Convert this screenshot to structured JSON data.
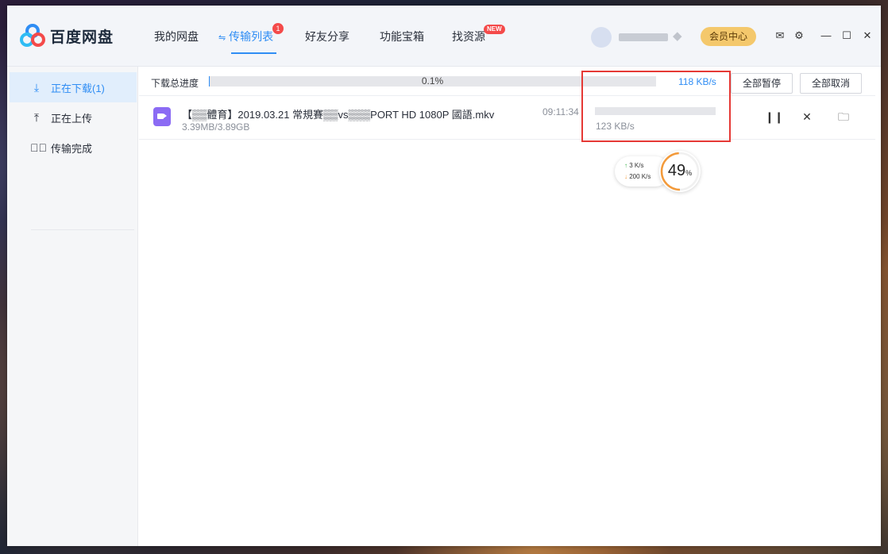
{
  "app": {
    "name": "百度网盘"
  },
  "nav": {
    "tabs": [
      {
        "label": "我的网盘"
      },
      {
        "label": "传输列表",
        "badge": "1"
      },
      {
        "label": "好友分享"
      },
      {
        "label": "功能宝箱"
      },
      {
        "label": "找资源",
        "badge": "NEW"
      }
    ],
    "active_tab": "传输列表",
    "vip_button": "会员中心"
  },
  "sidebar": {
    "items": [
      {
        "label": "正在下载(1)",
        "icon": "download-icon"
      },
      {
        "label": "正在上传",
        "icon": "upload-icon"
      },
      {
        "label": "传输完成",
        "icon": "check-circle-icon"
      }
    ]
  },
  "download_panel": {
    "progress_label": "下载总进度",
    "progress_text": "0.1%",
    "progress_fraction": 0.001,
    "total_speed": "118 KB/s",
    "pause_all": "全部暂停",
    "cancel_all": "全部取消"
  },
  "downloads": [
    {
      "name": "【▒▒體育】2019.03.21 常規賽▒▒vs▒▒▒PORT HD 1080P 國語.mkv",
      "size": "3.39MB/3.89GB",
      "time_left": "09:11:34",
      "speed": "123 KB/s",
      "progress_fraction": 0
    }
  ],
  "speed_widget": {
    "upload": "3   K/s",
    "download": "200 K/s",
    "percent": "49",
    "percent_unit": "%",
    "percent_fraction": 0.49
  },
  "colors": {
    "accent": "#2f8df4",
    "badge": "#f44a4a",
    "vip": "#f4c86c",
    "highlight_box": "#e53935"
  }
}
